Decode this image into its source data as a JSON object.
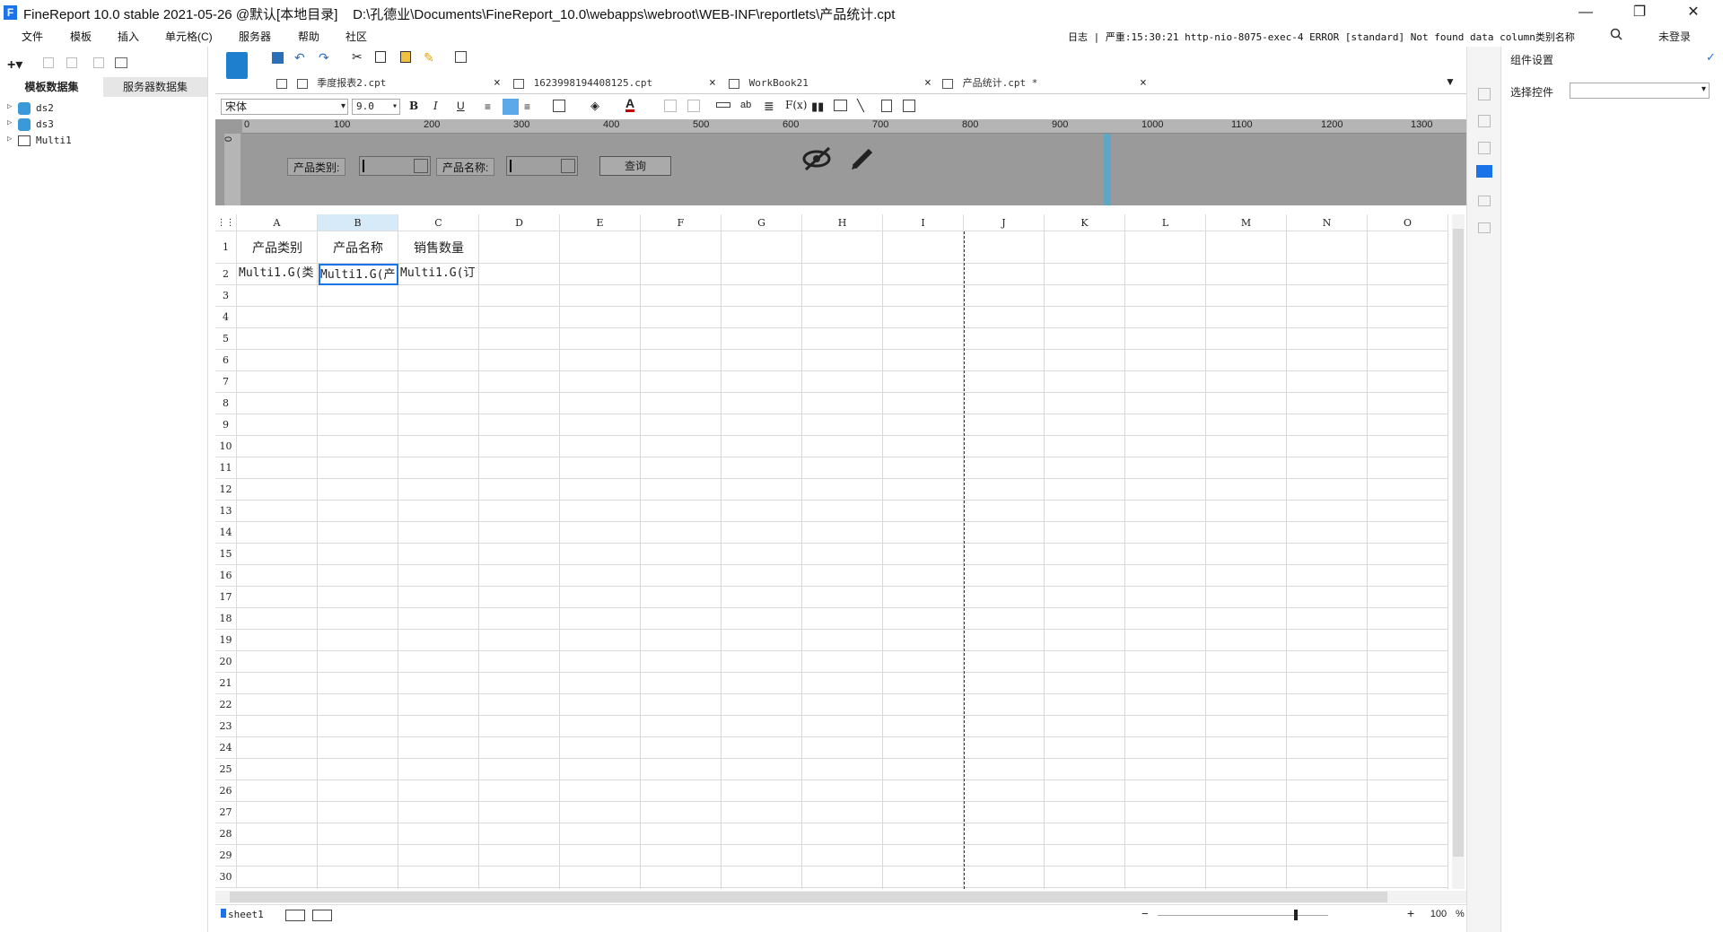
{
  "window": {
    "app_title": "FineReport 10.0 stable 2021-05-26 @默认[本地目录]",
    "file_path": "D:\\孔德业\\Documents\\FineReport_10.0\\webapps\\webroot\\WEB-INF\\reportlets\\产品统计.cpt",
    "logo_letter": "F",
    "minimize": "—",
    "maximize": "❐",
    "close": "✕"
  },
  "menu": {
    "items": [
      "文件",
      "模板",
      "插入",
      "单元格(C)",
      "服务器",
      "帮助",
      "社区"
    ],
    "status_text": "日志 | 严重:15:30:21 http-nio-8075-exec-4 ERROR [standard] Not found data column类别名称",
    "search_icon": "search-icon",
    "login": "未登录"
  },
  "left_panel": {
    "tabs": [
      "模板数据集",
      "服务器数据集"
    ],
    "datasets": [
      "ds2",
      "ds3",
      "Multi1"
    ]
  },
  "tabs": [
    {
      "label": "季度报表2.cpt",
      "active": false
    },
    {
      "label": "1623998194408125.cpt",
      "active": false
    },
    {
      "label": "WorkBook21",
      "active": false
    },
    {
      "label": "产品统计.cpt *",
      "active": true
    }
  ],
  "format_toolbar": {
    "font": "宋体",
    "size": "9.0"
  },
  "param_panel": {
    "ruler_labels": [
      "0",
      "100",
      "200",
      "300",
      "400",
      "500",
      "600",
      "700",
      "800",
      "900",
      "1000",
      "1100",
      "1200",
      "1300"
    ],
    "vruler_label": "0",
    "label1": "产品类别:",
    "label2": "产品名称:",
    "query_button": "查询"
  },
  "grid": {
    "columns": [
      "A",
      "B",
      "C",
      "D",
      "E",
      "F",
      "G",
      "H",
      "I",
      "J",
      "K",
      "L",
      "M",
      "N",
      "O"
    ],
    "selected_column": "B",
    "rows": [
      "1",
      "2",
      "3",
      "4",
      "5",
      "6",
      "7",
      "8",
      "9",
      "10",
      "11",
      "12",
      "13",
      "14",
      "15",
      "16",
      "17",
      "18",
      "19",
      "20",
      "21",
      "22",
      "23",
      "24",
      "25",
      "26",
      "27",
      "28",
      "29",
      "30"
    ],
    "cells": {
      "A1": "产品类别",
      "B1": "产品名称",
      "C1": "销售数量",
      "A2": "Multi1.G(类",
      "B2": "Multi1.G(产",
      "C2": "Multi1.G(订"
    }
  },
  "sheet_bar": {
    "sheet_name": "sheet1",
    "zoom": "100",
    "zoom_unit": "%",
    "zoom_minus": "−",
    "zoom_plus": "+"
  },
  "right_panel": {
    "title": "组件设置",
    "select_label": "选择控件"
  }
}
